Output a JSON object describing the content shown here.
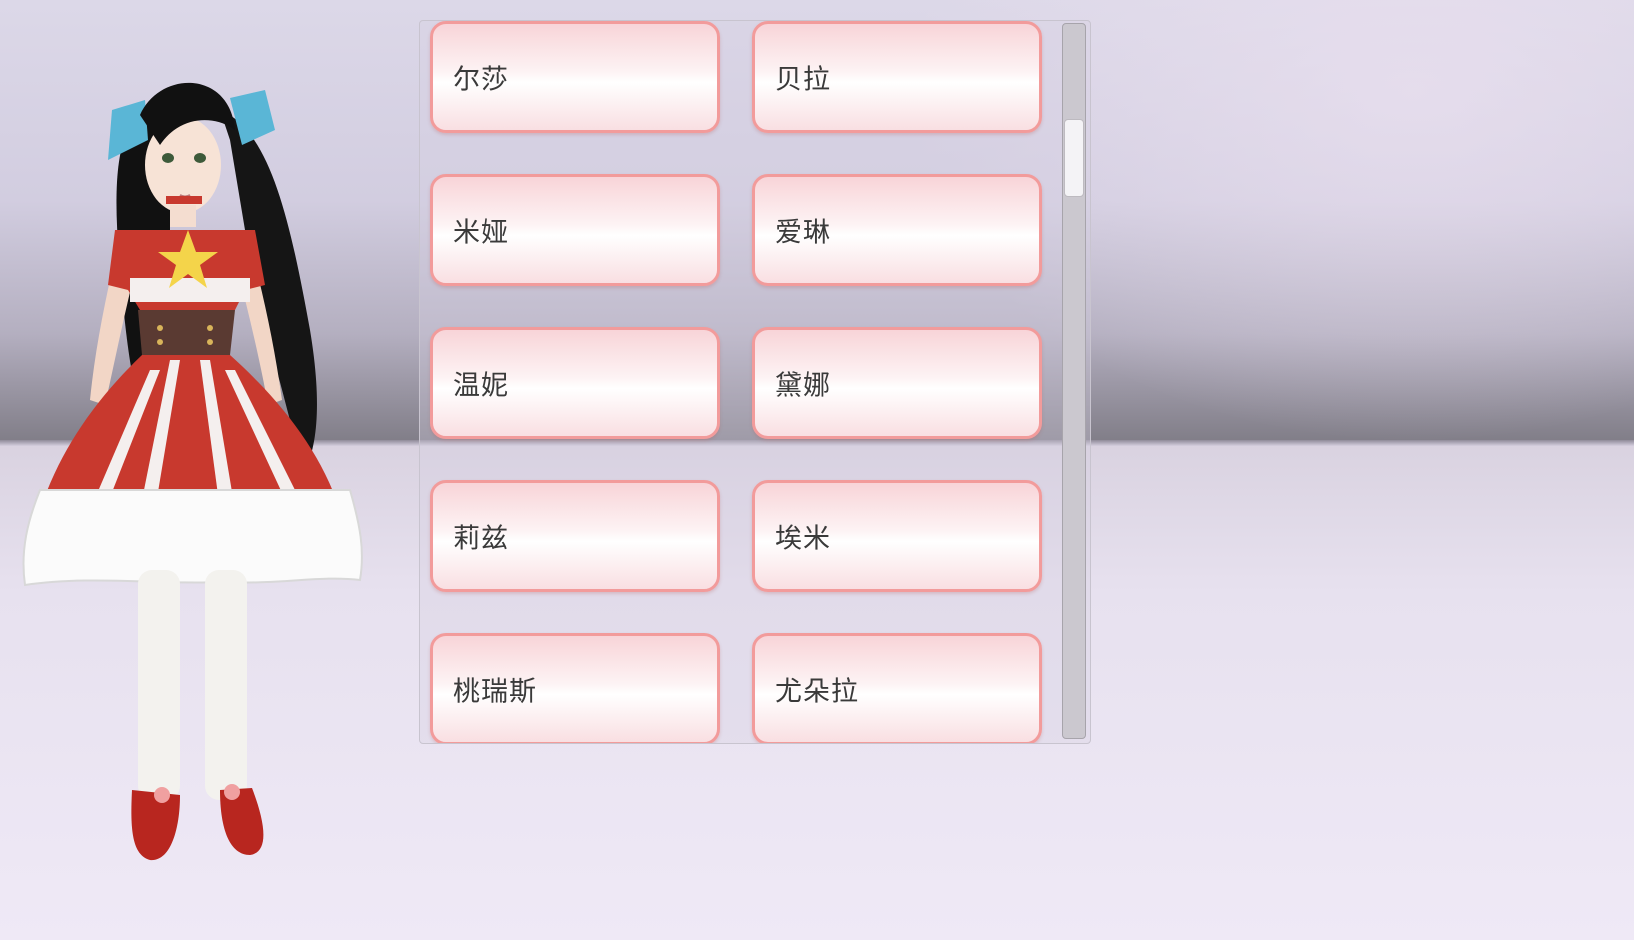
{
  "name_list": {
    "rows": [
      {
        "left": "尔莎",
        "right": "贝拉"
      },
      {
        "left": "米娅",
        "right": "爱琳"
      },
      {
        "left": "温妮",
        "right": "黛娜"
      },
      {
        "left": "莉兹",
        "right": "埃米"
      },
      {
        "left": "桃瑞斯",
        "right": "尤朵拉"
      }
    ]
  },
  "colors": {
    "button_border": "#f29b9b",
    "button_fill_top": "#f8d4d8",
    "dress_red": "#c8392e",
    "ribbon_blue": "#5ab6d6"
  },
  "icons": {
    "character": "character-model-icon"
  }
}
